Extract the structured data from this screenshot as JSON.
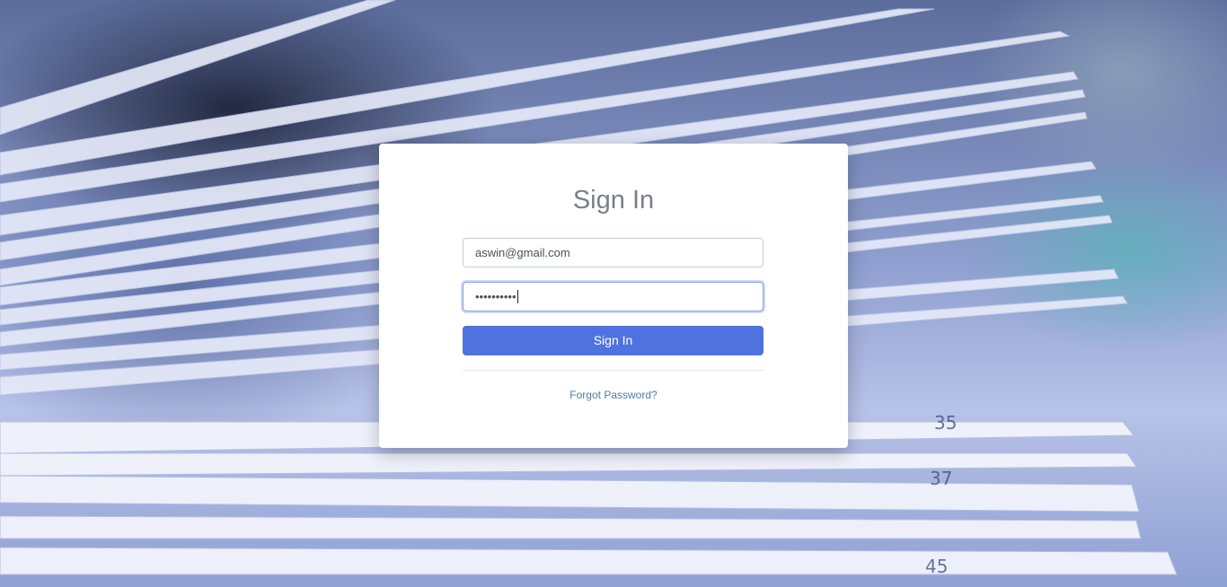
{
  "signin": {
    "title": "Sign In",
    "email_value": "aswin@gmail.com",
    "password_masked": "••••••••••",
    "submit_label": "Sign In",
    "forgot_label": "Forgot Password?"
  },
  "colors": {
    "primary_button": "#4e73df",
    "link": "#4a7fa8",
    "title_text": "#7a7f8c",
    "card": "#ffffff"
  },
  "background": {
    "page_numbers": [
      "35",
      "37",
      "45"
    ]
  }
}
